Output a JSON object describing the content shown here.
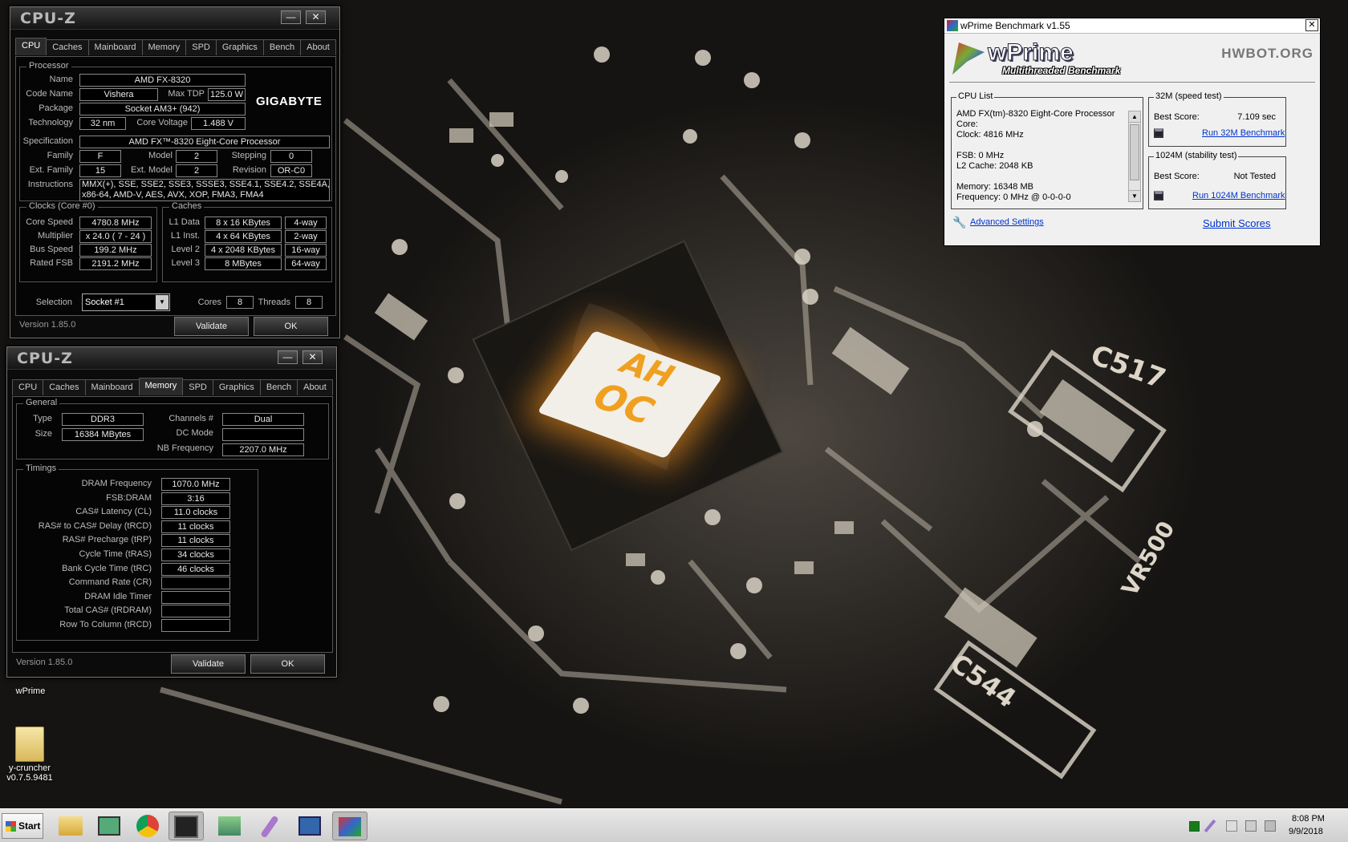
{
  "cpuz1": {
    "logo": "CPU-Z",
    "tabs": [
      "CPU",
      "Caches",
      "Mainboard",
      "Memory",
      "SPD",
      "Graphics",
      "Bench",
      "About"
    ],
    "processor": {
      "group": "Processor",
      "name_l": "Name",
      "name": "AMD FX-8320",
      "code_l": "Code Name",
      "code": "Vishera",
      "tdp_l": "Max TDP",
      "tdp": "125.0 W",
      "pkg_l": "Package",
      "pkg": "Socket AM3+ (942)",
      "tech_l": "Technology",
      "tech": "32 nm",
      "cv_l": "Core Voltage",
      "cv": "1.488 V",
      "brand": "GIGABYTE",
      "spec_l": "Specification",
      "spec": "AMD FX™-8320 Eight-Core Processor",
      "fam_l": "Family",
      "fam": "F",
      "model_l": "Model",
      "model": "2",
      "step_l": "Stepping",
      "step": "0",
      "efam_l": "Ext. Family",
      "efam": "15",
      "emodel_l": "Ext. Model",
      "emodel": "2",
      "rev_l": "Revision",
      "rev": "OR-C0",
      "inst_l": "Instructions",
      "inst1": "MMX(+), SSE, SSE2, SSE3, SSSE3, SSE4.1, SSE4.2, SSE4A,",
      "inst2": "x86-64, AMD-V, AES, AVX, XOP, FMA3, FMA4"
    },
    "clocks": {
      "group": "Clocks (Core #0)",
      "cs_l": "Core Speed",
      "cs": "4780.8 MHz",
      "mul_l": "Multiplier",
      "mul": "x 24.0 ( 7 - 24 )",
      "bus_l": "Bus Speed",
      "bus": "199.2 MHz",
      "fsb_l": "Rated FSB",
      "fsb": "2191.2 MHz"
    },
    "caches": {
      "group": "Caches",
      "l1d_l": "L1 Data",
      "l1d": "8 x 16 KBytes",
      "l1d_w": "4-way",
      "l1i_l": "L1 Inst.",
      "l1i": "4 x 64 KBytes",
      "l1i_w": "2-way",
      "l2_l": "Level 2",
      "l2": "4 x 2048 KBytes",
      "l2_w": "16-way",
      "l3_l": "Level 3",
      "l3": "8 MBytes",
      "l3_w": "64-way"
    },
    "sel_l": "Selection",
    "sel": "Socket #1",
    "cores_l": "Cores",
    "cores": "8",
    "threads_l": "Threads",
    "threads": "8",
    "version": "Version 1.85.0",
    "validate": "Validate",
    "ok": "OK"
  },
  "cpuz2": {
    "logo": "CPU-Z",
    "tabs": [
      "CPU",
      "Caches",
      "Mainboard",
      "Memory",
      "SPD",
      "Graphics",
      "Bench",
      "About"
    ],
    "general": {
      "group": "General",
      "type_l": "Type",
      "type": "DDR3",
      "size_l": "Size",
      "size": "16384 MBytes",
      "ch_l": "Channels #",
      "ch": "Dual",
      "dc_l": "DC Mode",
      "dc": "",
      "nb_l": "NB Frequency",
      "nb": "2207.0 MHz"
    },
    "timings": {
      "group": "Timings",
      "rows": [
        {
          "l": "DRAM Frequency",
          "v": "1070.0 MHz"
        },
        {
          "l": "FSB:DRAM",
          "v": "3:16"
        },
        {
          "l": "CAS# Latency (CL)",
          "v": "11.0 clocks"
        },
        {
          "l": "RAS# to CAS# Delay (tRCD)",
          "v": "11 clocks"
        },
        {
          "l": "RAS# Precharge (tRP)",
          "v": "11 clocks"
        },
        {
          "l": "Cycle Time (tRAS)",
          "v": "34 clocks"
        },
        {
          "l": "Bank Cycle Time (tRC)",
          "v": "46 clocks"
        },
        {
          "l": "Command Rate (CR)",
          "v": ""
        },
        {
          "l": "DRAM Idle Timer",
          "v": ""
        },
        {
          "l": "Total CAS# (tRDRAM)",
          "v": ""
        },
        {
          "l": "Row To Column (tRCD)",
          "v": ""
        }
      ]
    },
    "version": "Version 1.85.0",
    "validate": "Validate",
    "ok": "OK"
  },
  "wprime": {
    "title": "wPrime Benchmark v1.55",
    "logo": "wPrime",
    "subtitle": "Multithreaded Benchmark",
    "hwbot": "HWBOT.ORG",
    "cpulist_l": "CPU List",
    "cpulist": [
      "AMD FX(tm)-8320 Eight-Core Processor",
      "Core:",
      "Clock: 4816 MHz",
      "",
      "FSB: 0 MHz",
      "L2 Cache: 2048 KB",
      "",
      "Memory: 16348 MB",
      "Frequency: 0 MHz @ 0-0-0-0"
    ],
    "t32_l": "32M (speed test)",
    "best_l": "Best Score:",
    "t32_score": "7.109 sec",
    "run32": "Run 32M Benchmark",
    "t1024_l": "1024M (stability test)",
    "t1024_score": "Not Tested",
    "run1024": "Run 1024M Benchmark",
    "adv": "Advanced Settings",
    "submit": "Submit Scores"
  },
  "desktop": {
    "icon1": "wPrime",
    "icon2a": "y-cruncher",
    "icon2b": "v0.7.5.9481",
    "pcb_text1": "C517",
    "pcb_text2": "C544",
    "pcb_text3": "VR500",
    "chip_text1": "AH",
    "chip_text2": "OC"
  },
  "taskbar": {
    "start": "Start",
    "time": "8:08 PM",
    "date": "9/9/2018"
  }
}
